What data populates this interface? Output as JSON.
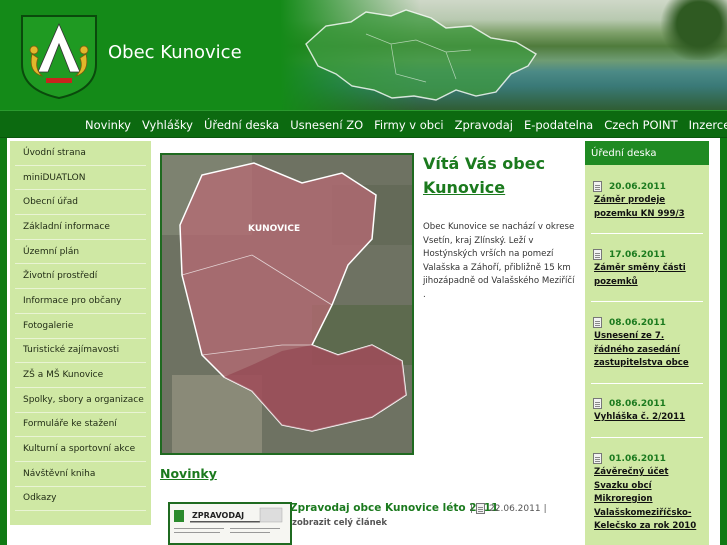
{
  "header": {
    "site_title": "Obec Kunovice"
  },
  "nav": {
    "items": [
      {
        "label": "Novinky"
      },
      {
        "label": "Vyhlášky"
      },
      {
        "label": "Úřední deska"
      },
      {
        "label": "Usnesení ZO"
      },
      {
        "label": "Firmy v obci"
      },
      {
        "label": "Zpravodaj"
      },
      {
        "label": "E-podatelna"
      },
      {
        "label": "Czech POINT"
      },
      {
        "label": "Inzerce"
      }
    ]
  },
  "sidebar": {
    "items": [
      {
        "label": "Úvodní strana"
      },
      {
        "label": "miniDUATLON"
      },
      {
        "label": "Obecní úřad"
      },
      {
        "label": "Základní informace"
      },
      {
        "label": "Územní plán"
      },
      {
        "label": "Životní prostředí"
      },
      {
        "label": "Informace pro občany"
      },
      {
        "label": "Fotogalerie"
      },
      {
        "label": "Turistické zajímavosti"
      },
      {
        "label": "ZŠ a MŠ Kunovice"
      },
      {
        "label": "Spolky, sbory a organizace"
      },
      {
        "label": "Formuláře ke stažení"
      },
      {
        "label": "Kulturní a sportovní akce"
      },
      {
        "label": "Návštěvní kniha"
      },
      {
        "label": "Odkazy"
      }
    ]
  },
  "main": {
    "map_label": "KUNOVICE",
    "welcome_line1": "Vítá Vás obec",
    "welcome_line2": "Kunovice",
    "welcome_text": "Obec Kunovice se nachází v okrese Vsetín, kraj Zlínský. Leží v Hostýnských vrších na pomezí Valašska a Záhoří, přibližně 15 km jihozápadně od Valašského Meziříčí .",
    "news_heading": "Novinky",
    "news_thumb_label": "ZPRAVODAJ",
    "news_item_title": "Zpravodaj obce Kunovice léto 2011",
    "news_item_sep": "|",
    "news_item_date": "22.06.2011",
    "news_item_sep2": "|",
    "news_item_more": "zobrazit celý článek"
  },
  "notice_board": {
    "heading": "Úřední deska",
    "items": [
      {
        "date": "20.06.2011",
        "title": "Záměr prodeje pozemku KN 999/3"
      },
      {
        "date": "17.06.2011",
        "title": "Záměr směny části pozemků"
      },
      {
        "date": "08.06.2011",
        "title": "Usnesení ze 7. řádného zasedání zastupitelstva obce"
      },
      {
        "date": "08.06.2011",
        "title": "Vyhláška č. 2/2011"
      },
      {
        "date": "01.06.2011",
        "title": "Závěrečný účet Svazku obcí Mikroregion Valašskomeziříčsko-Kelečsko za rok 2010"
      }
    ]
  },
  "colors": {
    "brand_green": "#148a18",
    "nav_green": "#0c6a10",
    "sidebar_bg": "#cfe8a4",
    "link_green": "#1b7a1e"
  }
}
